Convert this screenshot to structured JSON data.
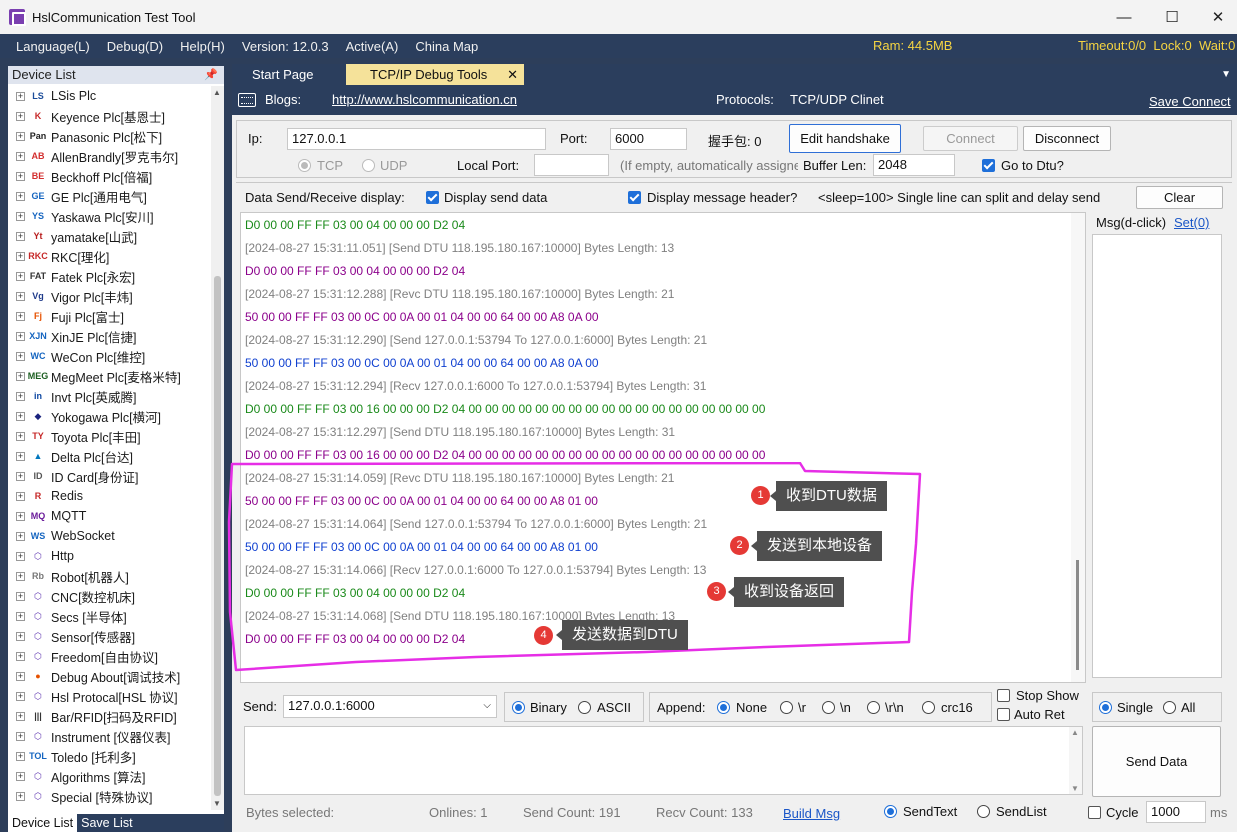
{
  "app": {
    "title": "HslCommunication Test Tool"
  },
  "menu": {
    "items": [
      "Language(L)",
      "Debug(D)",
      "Help(H)",
      "Version: 12.0.3",
      "Active(A)",
      "China Map"
    ],
    "ram": "Ram: 44.5MB",
    "timeout": "Timeout:0/0",
    "lock": "Lock:0",
    "wait": "Wait:0"
  },
  "device_list": {
    "title": "Device List",
    "pin": "📌",
    "items": [
      {
        "label": "LSis Plc",
        "icon": "LS",
        "color": "#1b4c9a"
      },
      {
        "label": "Keyence Plc[基恩士]",
        "icon": "K",
        "color": "#c62828"
      },
      {
        "label": "Panasonic Plc[松下]",
        "icon": "Pan",
        "color": "#222"
      },
      {
        "label": "AllenBrandly[罗克韦尔]",
        "icon": "AB",
        "color": "#d32f2f"
      },
      {
        "label": "Beckhoff Plc[倍福]",
        "icon": "BE",
        "color": "#d32f2f"
      },
      {
        "label": "GE Plc[通用电气]",
        "icon": "GE",
        "color": "#1565c0"
      },
      {
        "label": "Yaskawa Plc[安川]",
        "icon": "YS",
        "color": "#1565c0"
      },
      {
        "label": "yamatake[山武]",
        "icon": "Yt",
        "color": "#b71c1c"
      },
      {
        "label": "RKC[理化]",
        "icon": "RKC",
        "color": "#c62828"
      },
      {
        "label": "Fatek Plc[永宏]",
        "icon": "FAT",
        "color": "#333"
      },
      {
        "label": "Vigor Plc[丰炜]",
        "icon": "Vg",
        "color": "#1e3a8a"
      },
      {
        "label": "Fuji Plc[富士]",
        "icon": "Fj",
        "color": "#e65100"
      },
      {
        "label": "XinJE Plc[信捷]",
        "icon": "XJN",
        "color": "#1565c0"
      },
      {
        "label": "WeCon Plc[维控]",
        "icon": "WC",
        "color": "#1565c0"
      },
      {
        "label": "MegMeet Plc[麦格米特]",
        "icon": "MEG",
        "color": "#1b5e20"
      },
      {
        "label": "Invt Plc[英威腾]",
        "icon": "in",
        "color": "#0d47a1"
      },
      {
        "label": "Yokogawa Plc[横河]",
        "icon": "◆",
        "color": "#1a237e"
      },
      {
        "label": "Toyota Plc[丰田]",
        "icon": "TY",
        "color": "#c62828"
      },
      {
        "label": "Delta Plc[台达]",
        "icon": "▲",
        "color": "#0277bd"
      },
      {
        "label": "ID Card[身份证]",
        "icon": "ID",
        "color": "#555"
      },
      {
        "label": "Redis",
        "icon": "R",
        "color": "#c62828"
      },
      {
        "label": "MQTT",
        "icon": "MQ",
        "color": "#6a1b9a"
      },
      {
        "label": "WebSocket",
        "icon": "WS",
        "color": "#1565c0"
      },
      {
        "label": "Http",
        "icon": "⬡",
        "color": "#5e35b1"
      },
      {
        "label": "Robot[机器人]",
        "icon": "Rb",
        "color": "#777"
      },
      {
        "label": "CNC[数控机床]",
        "icon": "⬡",
        "color": "#5e35b1"
      },
      {
        "label": "Secs [半导体]",
        "icon": "⬡",
        "color": "#5e35b1"
      },
      {
        "label": "Sensor[传感器]",
        "icon": "⬡",
        "color": "#5e35b1"
      },
      {
        "label": "Freedom[自由协议]",
        "icon": "⬡",
        "color": "#5e35b1"
      },
      {
        "label": "Debug About[调试技术]",
        "icon": "●",
        "color": "#e65100"
      },
      {
        "label": "Hsl Protocal[HSL 协议]",
        "icon": "⬡",
        "color": "#5e35b1"
      },
      {
        "label": "Bar/RFID[扫码及RFID]",
        "icon": "|||",
        "color": "#333"
      },
      {
        "label": "Instrument [仪器仪表]",
        "icon": "⬡",
        "color": "#5e35b1"
      },
      {
        "label": "Toledo [托利多]",
        "icon": "TOL",
        "color": "#1565c0"
      },
      {
        "label": "Algorithms [算法]",
        "icon": "⬡",
        "color": "#5e35b1"
      },
      {
        "label": "Special [特殊协议]",
        "icon": "⬡",
        "color": "#5e35b1"
      }
    ],
    "tab_device": "Device List",
    "tab_save": "Save List"
  },
  "tabs": {
    "start": "Start Page",
    "tcp": "TCP/IP Debug Tools",
    "close": "✕",
    "more": "▼"
  },
  "blogs": {
    "label": "Blogs:",
    "url": "http://www.hslcommunication.cn",
    "protocols_label": "Protocols:",
    "protocols": "TCP/UDP Clinet",
    "save": "Save Connect"
  },
  "conn": {
    "ip_label": "Ip:",
    "ip": "127.0.0.1",
    "port_label": "Port:",
    "port": "6000",
    "handshake": "握手包:  0",
    "edit_handshake": "Edit handshake",
    "connect": "Connect",
    "disconnect": "Disconnect",
    "tcp": "TCP",
    "udp": "UDP",
    "local_port_label": "Local Port:",
    "local_port_hint": "(If empty, automatically assigne",
    "buffer_label": "Buffer Len:",
    "buffer": "2048",
    "go_dtu": "Go to Dtu?"
  },
  "display": {
    "label": "Data Send/Receive display:",
    "send_data": "Display send data",
    "msg_header": "Display message header?",
    "sleep": "<sleep=100> Single line can split and delay send",
    "clear": "Clear"
  },
  "log": {
    "lines": [
      {
        "t": "D0 00 00 FF FF 03 00 04 00 00 00 D2 04",
        "c": "#1a8a1a"
      },
      {
        "t": "[2024-08-27 15:31:11.051] [Send DTU 118.195.180.167:10000]  Bytes Length: 13",
        "c": "#808080"
      },
      {
        "t": "D0 00 00 FF FF 03 00 04 00 00 00 D2 04",
        "c": "#8b008b"
      },
      {
        "t": "[2024-08-27 15:31:12.288] [Revc DTU 118.195.180.167:10000]  Bytes Length: 21",
        "c": "#808080"
      },
      {
        "t": "50 00 00 FF FF 03 00 0C 00 0A 00 01 04 00 00 64 00 00 A8 0A 00",
        "c": "#8b008b"
      },
      {
        "t": "[2024-08-27 15:31:12.290] [Send 127.0.0.1:53794 To 127.0.0.1:6000]  Bytes Length: 21",
        "c": "#808080"
      },
      {
        "t": "50 00 00 FF FF 03 00 0C 00 0A 00 01 04 00 00 64 00 00 A8 0A 00",
        "c": "#1040d0"
      },
      {
        "t": "[2024-08-27 15:31:12.294] [Recv 127.0.0.1:6000 To 127.0.0.1:53794]  Bytes Length: 31",
        "c": "#808080"
      },
      {
        "t": "D0 00 00 FF FF 03 00 16 00 00 00 D2 04 00 00 00 00 00 00 00 00 00 00 00 00 00 00 00 00 00 00",
        "c": "#1a8a1a"
      },
      {
        "t": "[2024-08-27 15:31:12.297] [Send DTU 118.195.180.167:10000]  Bytes Length: 31",
        "c": "#808080"
      },
      {
        "t": "D0 00 00 FF FF 03 00 16 00 00 00 D2 04 00 00 00 00 00 00 00 00 00 00 00 00 00 00 00 00 00 00",
        "c": "#8b008b"
      },
      {
        "t": "[2024-08-27 15:31:14.059] [Revc DTU 118.195.180.167:10000]  Bytes Length: 21",
        "c": "#808080"
      },
      {
        "t": "50 00 00 FF FF 03 00 0C 00 0A 00 01 04 00 00 64 00 00 A8 01 00",
        "c": "#8b008b"
      },
      {
        "t": "[2024-08-27 15:31:14.064] [Send 127.0.0.1:53794 To 127.0.0.1:6000]  Bytes Length: 21",
        "c": "#808080"
      },
      {
        "t": "50 00 00 FF FF 03 00 0C 00 0A 00 01 04 00 00 64 00 00 A8 01 00",
        "c": "#1040d0"
      },
      {
        "t": "[2024-08-27 15:31:14.066] [Recv 127.0.0.1:6000 To 127.0.0.1:53794]  Bytes Length: 13",
        "c": "#808080"
      },
      {
        "t": "D0 00 00 FF FF 03 00 04 00 00 00 D2 04",
        "c": "#1a8a1a"
      },
      {
        "t": "[2024-08-27 15:31:14.068] [Send DTU 118.195.180.167:10000]  Bytes Length: 13",
        "c": "#808080"
      },
      {
        "t": "D0 00 00 FF FF 03 00 04 00 00 00 D2 04",
        "c": "#8b008b"
      }
    ]
  },
  "callouts": [
    {
      "n": "1",
      "text": "收到DTU数据"
    },
    {
      "n": "2",
      "text": "发送到本地设备"
    },
    {
      "n": "3",
      "text": "收到设备返回"
    },
    {
      "n": "4",
      "text": "发送数据到DTU"
    }
  ],
  "msg": {
    "label": "Msg(d-click)",
    "set": "Set(0)"
  },
  "send": {
    "label": "Send:",
    "target": "127.0.0.1:6000",
    "binary": "Binary",
    "ascii": "ASCII",
    "append_label": "Append:",
    "none": "None",
    "r": "\\r",
    "n": "\\n",
    "rn": "\\r\\n",
    "crc16": "crc16",
    "stop_show": "Stop Show",
    "auto_ret": "Auto Ret",
    "single": "Single",
    "all": "All",
    "send_data": "Send Data"
  },
  "status": {
    "bytes_selected": "Bytes selected:",
    "onlines": "Onlines: 1",
    "send_count": "Send Count: 191",
    "recv_count": "Recv Count: 133",
    "build_msg": "Build Msg",
    "sendtext": "SendText",
    "sendlist": "SendList",
    "cycle": "Cycle",
    "cycle_value": "1000",
    "ms": "ms"
  }
}
